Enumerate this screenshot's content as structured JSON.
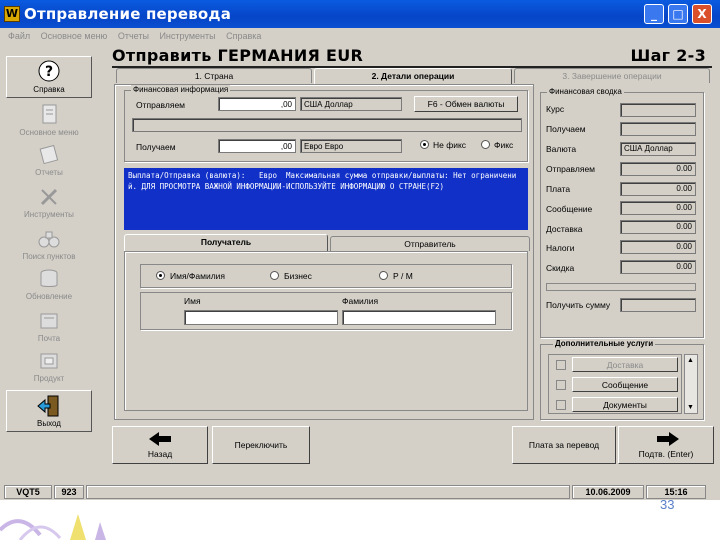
{
  "app": {
    "logo": "W",
    "title": "Отправление перевода",
    "controls": [
      "_",
      "□",
      "X"
    ]
  },
  "menu": [
    "Файл",
    "Основное меню",
    "Отчеты",
    "Инструменты",
    "Справка"
  ],
  "sidebar": [
    {
      "label": "Справка",
      "icon": "help-icon"
    },
    {
      "label": "Основное меню",
      "icon": "document-icon"
    },
    {
      "label": "Отчеты",
      "icon": "report-icon"
    },
    {
      "label": "Инструменты",
      "icon": "tools-icon"
    },
    {
      "label": "Поиск пунктов",
      "icon": "binoculars-icon"
    },
    {
      "label": "Обновление",
      "icon": "database-icon"
    },
    {
      "label": "Почта",
      "icon": "mail-icon"
    },
    {
      "label": "Продукт",
      "icon": "product-icon"
    },
    {
      "label": "Выход",
      "icon": "exit-icon"
    }
  ],
  "header": {
    "title": "Отправить ГЕРМАНИЯ EUR",
    "step": "Шаг 2-3"
  },
  "tabs": [
    "1. Страна",
    "2. Детали операции",
    "3. Завершение операции"
  ],
  "fin": {
    "group": "Финансовая информация",
    "send_label": "Отправляем",
    "send_value": ",00",
    "send_currency": "США Доллар",
    "fx_button": "F6 - Обмен валюты",
    "recv_label": "Получаем",
    "recv_value": ",00",
    "recv_currency": "Евро Евро",
    "fixed_no": "Не фикс",
    "fixed_yes": "Фикс"
  },
  "info_text": "Выплата/Отправка (валюта):   Евро  Максимальная сумма отправки/выплаты: Нет ограничений. ДЛЯ ПРОСМОТРА ВАЖНОЙ ИНФОРМАЦИИ-ИСПОЛЬЗУЙТЕ ИНФОРМАЦИЮ О СТРАНЕ(F2)",
  "subtabs": [
    "Получатель",
    "Отправитель"
  ],
  "recipient": {
    "type_person": "Имя/Фамилия",
    "type_business": "Бизнес",
    "type_po": "Р / М",
    "first_name_label": "Имя",
    "last_name_label": "Фамилия",
    "first_name": "",
    "last_name": ""
  },
  "summary": {
    "group": "Финансовая сводка",
    "rows": [
      {
        "label": "Курс",
        "value": ""
      },
      {
        "label": "Получаем",
        "value": ""
      },
      {
        "label": "Валюта",
        "value": "США Доллар"
      },
      {
        "label": "Отправляем",
        "value": "0.00"
      },
      {
        "label": "Плата",
        "value": "0.00"
      },
      {
        "label": "Сообщение",
        "value": "0.00"
      },
      {
        "label": "Доставка",
        "value": "0.00"
      },
      {
        "label": "Налоги",
        "value": "0.00"
      },
      {
        "label": "Скидка",
        "value": "0.00"
      }
    ],
    "get_sum_label": "Получить сумму",
    "get_sum_value": ""
  },
  "extra": {
    "group": "Дополнительные услуги",
    "items": [
      "Доставка",
      "Сообщение",
      "Документы"
    ]
  },
  "nav": {
    "back": "Назад",
    "switch": "Переключить",
    "fee": "Плата за перевод",
    "next": "Подтв. (Enter)"
  },
  "status": {
    "terminal": "VQT5",
    "code": "923",
    "date": "10.06.2009",
    "time": "15:16"
  },
  "page_number": "33"
}
